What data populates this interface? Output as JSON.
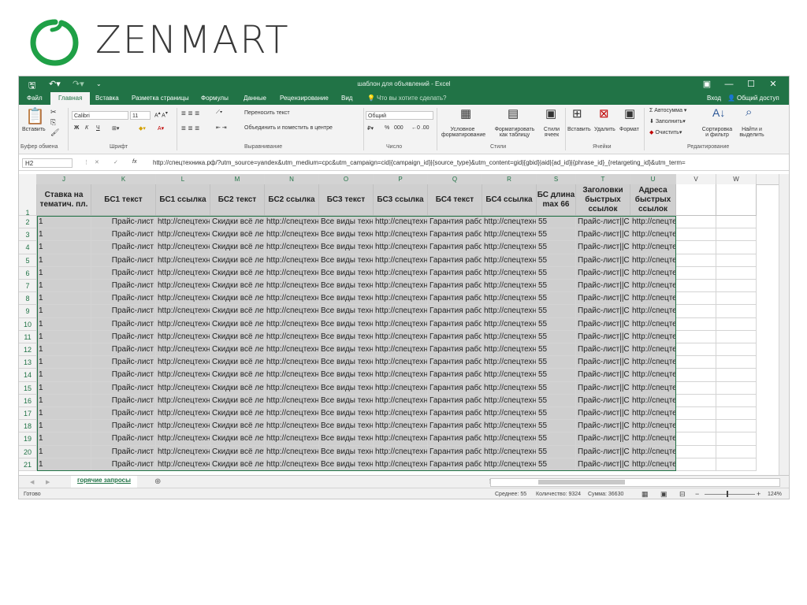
{
  "logo": {
    "text": "ZENMART",
    "color": "#1fa046"
  },
  "excel": {
    "title": "шаблон для объявлений - Excel",
    "qat": {
      "save_icon": "save-icon",
      "undo_icon": "undo-icon",
      "redo_icon": "redo-icon"
    },
    "window_controls": [
      "▣",
      "—",
      "☐",
      "✕"
    ],
    "tabs": [
      "Файл",
      "Главная",
      "Вставка",
      "Разметка страницы",
      "Формулы",
      "Данные",
      "Рецензирование",
      "Вид"
    ],
    "active_tab": "Главная",
    "tell_me": "Что вы хотите сделать?",
    "signin": "Вход",
    "share": "Общий доступ",
    "ribbon": {
      "clipboard": {
        "paste": "Вставить",
        "label": "Буфер обмена"
      },
      "font": {
        "name": "Calibri",
        "size": "11",
        "bold": "Ж",
        "italic": "К",
        "underline": "Ч",
        "label": "Шрифт"
      },
      "alignment": {
        "wrap": "Переносить текст",
        "merge": "Объединить и поместить в центре",
        "label": "Выравнивание"
      },
      "number": {
        "format": "Общий",
        "percent": "%",
        "thousands": "000",
        "label": "Число"
      },
      "styles": {
        "conditional": "Условное форматирование",
        "as_table": "Форматировать как таблицу",
        "cell_styles": "Стили ячеек",
        "label": "Стили"
      },
      "cells": {
        "insert": "Вставить",
        "delete": "Удалить",
        "format": "Формат",
        "label": "Ячейки"
      },
      "editing": {
        "autosum": "Автосумма",
        "fill": "Заполнить",
        "clear": "Очистить",
        "sort": "Сортировка и фильтр",
        "find": "Найти и выделить",
        "label": "Редактирование"
      }
    },
    "name_box": "H2",
    "formula": "http://спецтехника.рф/?utm_source=yandex&utm_medium=cpc&utm_campaign=cid|{campaign_id}|{source_type}&utm_content=gid|{gbid}|aid|{ad_id}|{phrase_id}_{retargeting_id}&utm_term=",
    "columns": [
      "J",
      "K",
      "L",
      "M",
      "N",
      "O",
      "P",
      "Q",
      "R",
      "S",
      "T",
      "U",
      "V",
      "W"
    ],
    "headers": [
      "Ставка на тематич. пл.",
      "БС1 текст",
      "БС1 ссылка",
      "БС2 текст",
      "БС2 ссылка",
      "БС3 текст",
      "БС3 ссылка",
      "БС4 текст",
      "БС4 ссылка",
      "БС длина max 66",
      "Заголовки быстрых ссылок",
      "Адреса быстрых ссылок",
      "",
      ""
    ],
    "row_values": [
      "1",
      "Прайс-лист",
      "http://спецтехника.рф",
      "Скидки всё лето",
      "http://спецтехника.рф",
      "Все виды техники",
      "http://спецтехника.рф",
      "Гарантия работы",
      "http://спецтехника.рф",
      "55",
      "Прайс-лист||Скидки",
      "http://спецтехника.рф/#price?utm_source=yandex",
      "",
      ""
    ],
    "row_numbers": [
      "1",
      "2",
      "3",
      "4",
      "5",
      "6",
      "7",
      "8",
      "9",
      "10",
      "11",
      "12",
      "13",
      "14",
      "15",
      "16",
      "17",
      "18",
      "19",
      "20",
      "21"
    ],
    "sheet_tab": "горячие запросы",
    "status": {
      "ready": "Готово",
      "average": "Среднее: 55",
      "count": "Количество: 9324",
      "sum": "Сумма: 36630",
      "zoom": "124%"
    }
  }
}
